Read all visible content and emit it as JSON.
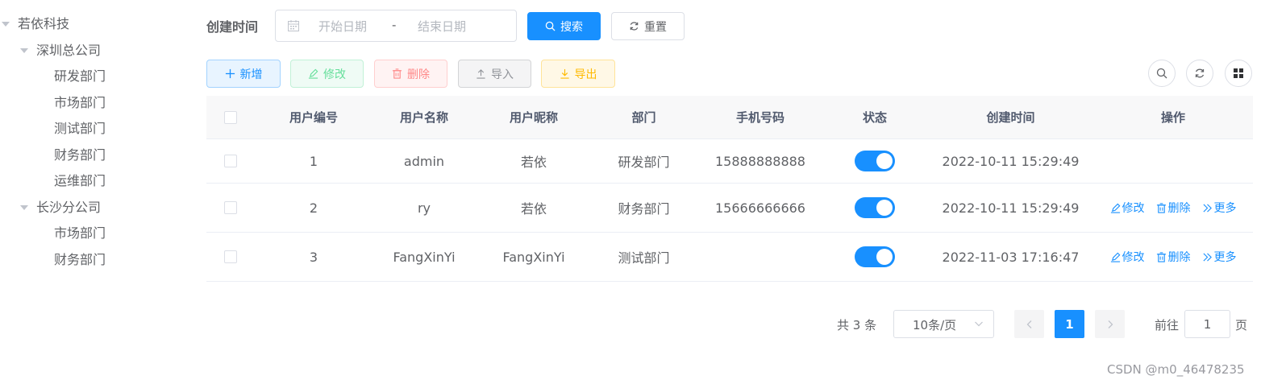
{
  "tree": {
    "root": "若依科技",
    "shenzhen": "深圳总公司",
    "shenzhen_children": [
      "研发部门",
      "市场部门",
      "测试部门",
      "财务部门",
      "运维部门"
    ],
    "changsha": "长沙分公司",
    "changsha_children": [
      "市场部门",
      "财务部门"
    ]
  },
  "search": {
    "label": "创建时间",
    "start_placeholder": "开始日期",
    "separator": "-",
    "end_placeholder": "结束日期",
    "search_button": "搜索",
    "reset_button": "重置"
  },
  "toolbar": {
    "add": "新增",
    "edit": "修改",
    "delete": "删除",
    "import": "导入",
    "export": "导出"
  },
  "table": {
    "columns": [
      "用户编号",
      "用户名称",
      "用户昵称",
      "部门",
      "手机号码",
      "状态",
      "创建时间",
      "操作"
    ],
    "rows": [
      {
        "id": "1",
        "username": "admin",
        "nickname": "若依",
        "dept": "研发部门",
        "phone": "15888888888",
        "status": true,
        "created": "2022-10-11 15:29:49",
        "ops": []
      },
      {
        "id": "2",
        "username": "ry",
        "nickname": "若依",
        "dept": "财务部门",
        "phone": "15666666666",
        "status": true,
        "created": "2022-10-11 15:29:49",
        "ops": [
          "修改",
          "删除",
          "更多"
        ]
      },
      {
        "id": "3",
        "username": "FangXinYi",
        "nickname": "FangXinYi",
        "dept": "测试部门",
        "phone": "",
        "status": true,
        "created": "2022-11-03 17:16:47",
        "ops": [
          "修改",
          "删除",
          "更多"
        ]
      }
    ]
  },
  "pagination": {
    "total": "共 3 条",
    "page_size": "10条/页",
    "current_page": "1",
    "goto_label": "前往",
    "goto_value": "1",
    "page_suffix": "页"
  },
  "watermark": "CSDN @m0_46478235",
  "colors": {
    "primary": "#1890ff",
    "success": "#13ce66",
    "danger": "#ff4949",
    "warning": "#ffba00",
    "info": "#909399"
  }
}
